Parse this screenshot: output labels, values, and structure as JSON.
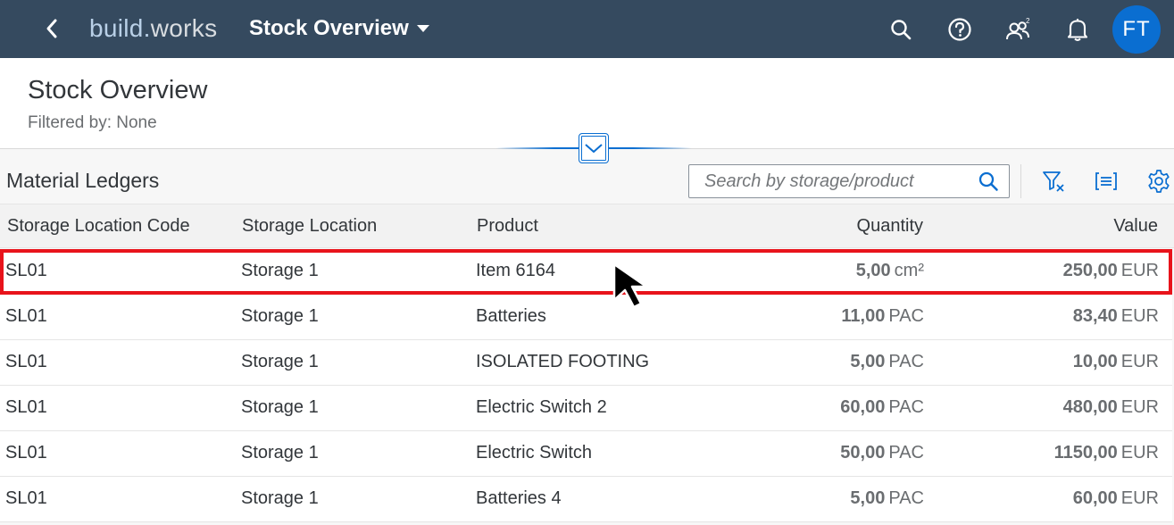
{
  "shell": {
    "brand_prefix": "build",
    "brand_dot": ".",
    "brand_suffix": "works",
    "app_title": "Stock Overview",
    "avatar_initials": "FT",
    "icons": [
      "back-icon",
      "search-icon",
      "help-icon",
      "people-icon",
      "notification-bell-icon"
    ]
  },
  "page": {
    "title": "Stock Overview",
    "filtered_by": "Filtered by: None"
  },
  "table": {
    "title": "Material Ledgers",
    "search_placeholder": "Search by storage/product",
    "columns": [
      "Storage Location Code",
      "Storage Location",
      "Product",
      "Quantity",
      "Value"
    ],
    "rows": [
      {
        "code": "SL01",
        "location": "Storage 1",
        "product": "Item 6164",
        "qty": "5,00",
        "qty_unit": "cm²",
        "value": "250,00",
        "value_unit": "EUR"
      },
      {
        "code": "SL01",
        "location": "Storage 1",
        "product": "Batteries",
        "qty": "11,00",
        "qty_unit": "PAC",
        "value": "83,40",
        "value_unit": "EUR"
      },
      {
        "code": "SL01",
        "location": "Storage 1",
        "product": "ISOLATED FOOTING",
        "qty": "5,00",
        "qty_unit": "PAC",
        "value": "10,00",
        "value_unit": "EUR"
      },
      {
        "code": "SL01",
        "location": "Storage 1",
        "product": "Electric Switch 2",
        "qty": "60,00",
        "qty_unit": "PAC",
        "value": "480,00",
        "value_unit": "EUR"
      },
      {
        "code": "SL01",
        "location": "Storage 1",
        "product": "Electric Switch",
        "qty": "50,00",
        "qty_unit": "PAC",
        "value": "1150,00",
        "value_unit": "EUR"
      },
      {
        "code": "SL01",
        "location": "Storage 1",
        "product": "Batteries 4",
        "qty": "5,00",
        "qty_unit": "PAC",
        "value": "60,00",
        "value_unit": "EUR"
      }
    ]
  },
  "colors": {
    "shell_bg": "#354a5f",
    "accent": "#0a6ed1",
    "highlight_border": "#e8131b"
  }
}
